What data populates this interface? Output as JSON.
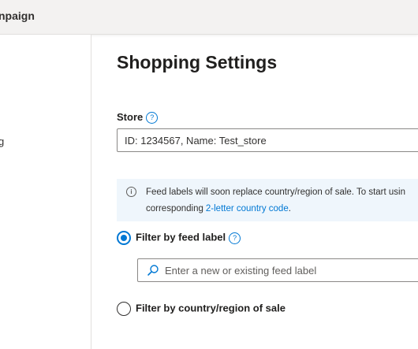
{
  "header": {
    "title_fragment": "npaign"
  },
  "sidebar": {
    "nav_fragment": "g"
  },
  "page": {
    "title": "Shopping Settings",
    "store": {
      "label": "Store",
      "help_glyph": "?",
      "value": "ID: 1234567, Name: Test_store"
    },
    "info": {
      "icon_glyph": "i",
      "line1": "Feed labels will soon replace country/region of sale. To start usin",
      "line2_text": "corresponding",
      "link_text": "2-letter country code",
      "line2_suffix": "."
    },
    "filters": {
      "feed_label": {
        "label": "Filter by feed label",
        "help_glyph": "?",
        "selected": true
      },
      "feed_label_input": {
        "placeholder": "Enter a new or existing feed label",
        "value": ""
      },
      "country": {
        "label": "Filter by country/region of sale",
        "selected": false
      }
    }
  },
  "colors": {
    "accent": "#0078d4",
    "info_bg": "#eff6fc",
    "topbar_bg": "#f3f2f1"
  },
  "icons": {
    "search": "search-icon",
    "help": "help-icon",
    "info": "info-icon"
  }
}
